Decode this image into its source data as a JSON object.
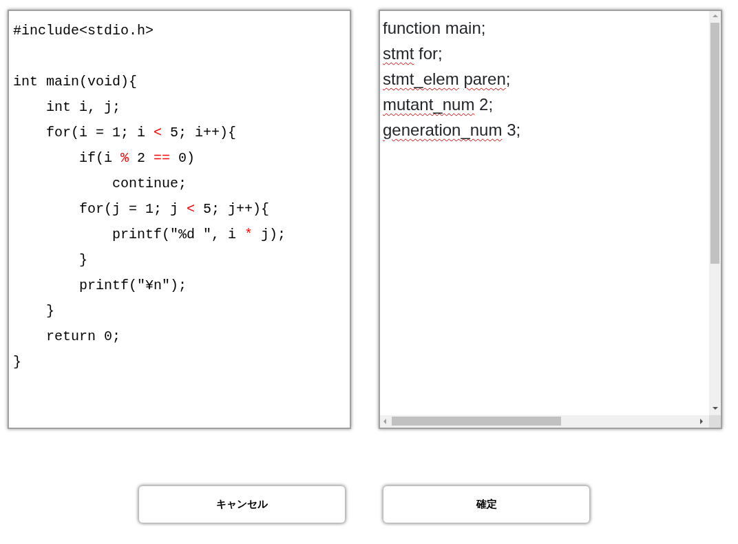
{
  "code_panel": {
    "lines": [
      [
        {
          "text": "#include<stdio.h>",
          "highlight": false
        }
      ],
      [
        {
          "blank": true
        }
      ],
      [
        {
          "text": "int main(void){",
          "highlight": false
        }
      ],
      [
        {
          "text": "    int i, j;",
          "highlight": false
        }
      ],
      [
        {
          "text": "    for(i = 1; i ",
          "highlight": false
        },
        {
          "text": "<",
          "highlight": true
        },
        {
          "text": " 5; i++){",
          "highlight": false
        }
      ],
      [
        {
          "text": "        if(i ",
          "highlight": false
        },
        {
          "text": "%",
          "highlight": true
        },
        {
          "text": " 2 ",
          "highlight": false
        },
        {
          "text": "==",
          "highlight": true
        },
        {
          "text": " 0)",
          "highlight": false
        }
      ],
      [
        {
          "text": "            continue;",
          "highlight": false
        }
      ],
      [
        {
          "text": "        for(j = 1; j ",
          "highlight": false
        },
        {
          "text": "<",
          "highlight": true
        },
        {
          "text": " 5; j++){",
          "highlight": false
        }
      ],
      [
        {
          "text": "            printf(\"%d \", i ",
          "highlight": false
        },
        {
          "text": "*",
          "highlight": true
        },
        {
          "text": " j);",
          "highlight": false
        }
      ],
      [
        {
          "text": "        }",
          "highlight": false
        }
      ],
      [
        {
          "text": "        printf(\"¥n\");",
          "highlight": false
        }
      ],
      [
        {
          "text": "    }",
          "highlight": false
        }
      ],
      [
        {
          "text": "    return 0;",
          "highlight": false
        }
      ],
      [
        {
          "text": "}",
          "highlight": false
        }
      ]
    ]
  },
  "settings_panel": {
    "lines": [
      [
        {
          "text": "function main;",
          "misspelled": false
        }
      ],
      [
        {
          "text": "stmt",
          "misspelled": true
        },
        {
          "text": " for;",
          "misspelled": false
        }
      ],
      [
        {
          "text": "stmt_elem",
          "misspelled": true
        },
        {
          "text": "paren",
          "misspelled": true,
          "space_before": true
        },
        {
          "text": ";",
          "misspelled": false
        }
      ],
      [
        {
          "text": "mutant_num",
          "misspelled": true
        },
        {
          "text": " 2;",
          "misspelled": false
        }
      ],
      [
        {
          "text": "generation_num",
          "misspelled": true
        },
        {
          "text": " 3;",
          "misspelled": false
        }
      ]
    ]
  },
  "buttons": [
    "キャンセル",
    "確定"
  ]
}
